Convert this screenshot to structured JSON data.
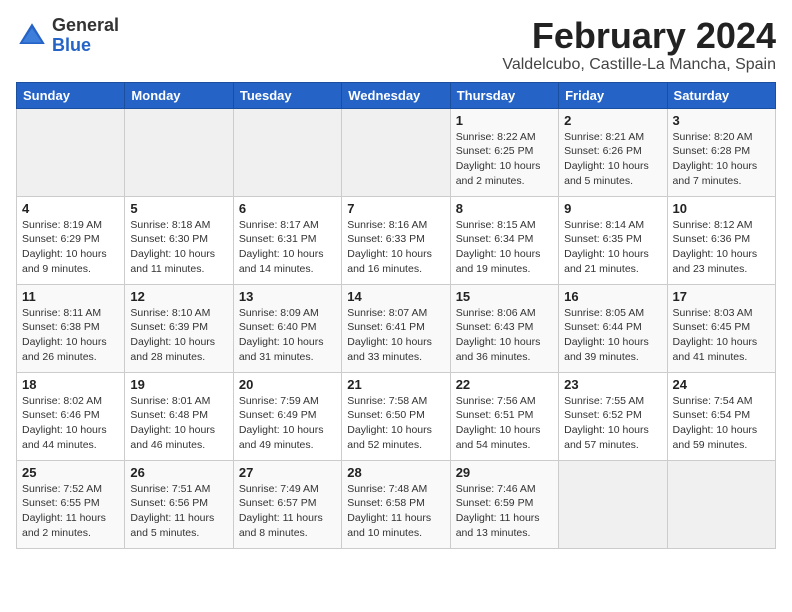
{
  "header": {
    "logo_general": "General",
    "logo_blue": "Blue",
    "month_title": "February 2024",
    "location": "Valdelcubo, Castille-La Mancha, Spain"
  },
  "weekdays": [
    "Sunday",
    "Monday",
    "Tuesday",
    "Wednesday",
    "Thursday",
    "Friday",
    "Saturday"
  ],
  "weeks": [
    [
      {
        "day": "",
        "info": ""
      },
      {
        "day": "",
        "info": ""
      },
      {
        "day": "",
        "info": ""
      },
      {
        "day": "",
        "info": ""
      },
      {
        "day": "1",
        "info": "Sunrise: 8:22 AM\nSunset: 6:25 PM\nDaylight: 10 hours\nand 2 minutes."
      },
      {
        "day": "2",
        "info": "Sunrise: 8:21 AM\nSunset: 6:26 PM\nDaylight: 10 hours\nand 5 minutes."
      },
      {
        "day": "3",
        "info": "Sunrise: 8:20 AM\nSunset: 6:28 PM\nDaylight: 10 hours\nand 7 minutes."
      }
    ],
    [
      {
        "day": "4",
        "info": "Sunrise: 8:19 AM\nSunset: 6:29 PM\nDaylight: 10 hours\nand 9 minutes."
      },
      {
        "day": "5",
        "info": "Sunrise: 8:18 AM\nSunset: 6:30 PM\nDaylight: 10 hours\nand 11 minutes."
      },
      {
        "day": "6",
        "info": "Sunrise: 8:17 AM\nSunset: 6:31 PM\nDaylight: 10 hours\nand 14 minutes."
      },
      {
        "day": "7",
        "info": "Sunrise: 8:16 AM\nSunset: 6:33 PM\nDaylight: 10 hours\nand 16 minutes."
      },
      {
        "day": "8",
        "info": "Sunrise: 8:15 AM\nSunset: 6:34 PM\nDaylight: 10 hours\nand 19 minutes."
      },
      {
        "day": "9",
        "info": "Sunrise: 8:14 AM\nSunset: 6:35 PM\nDaylight: 10 hours\nand 21 minutes."
      },
      {
        "day": "10",
        "info": "Sunrise: 8:12 AM\nSunset: 6:36 PM\nDaylight: 10 hours\nand 23 minutes."
      }
    ],
    [
      {
        "day": "11",
        "info": "Sunrise: 8:11 AM\nSunset: 6:38 PM\nDaylight: 10 hours\nand 26 minutes."
      },
      {
        "day": "12",
        "info": "Sunrise: 8:10 AM\nSunset: 6:39 PM\nDaylight: 10 hours\nand 28 minutes."
      },
      {
        "day": "13",
        "info": "Sunrise: 8:09 AM\nSunset: 6:40 PM\nDaylight: 10 hours\nand 31 minutes."
      },
      {
        "day": "14",
        "info": "Sunrise: 8:07 AM\nSunset: 6:41 PM\nDaylight: 10 hours\nand 33 minutes."
      },
      {
        "day": "15",
        "info": "Sunrise: 8:06 AM\nSunset: 6:43 PM\nDaylight: 10 hours\nand 36 minutes."
      },
      {
        "day": "16",
        "info": "Sunrise: 8:05 AM\nSunset: 6:44 PM\nDaylight: 10 hours\nand 39 minutes."
      },
      {
        "day": "17",
        "info": "Sunrise: 8:03 AM\nSunset: 6:45 PM\nDaylight: 10 hours\nand 41 minutes."
      }
    ],
    [
      {
        "day": "18",
        "info": "Sunrise: 8:02 AM\nSunset: 6:46 PM\nDaylight: 10 hours\nand 44 minutes."
      },
      {
        "day": "19",
        "info": "Sunrise: 8:01 AM\nSunset: 6:48 PM\nDaylight: 10 hours\nand 46 minutes."
      },
      {
        "day": "20",
        "info": "Sunrise: 7:59 AM\nSunset: 6:49 PM\nDaylight: 10 hours\nand 49 minutes."
      },
      {
        "day": "21",
        "info": "Sunrise: 7:58 AM\nSunset: 6:50 PM\nDaylight: 10 hours\nand 52 minutes."
      },
      {
        "day": "22",
        "info": "Sunrise: 7:56 AM\nSunset: 6:51 PM\nDaylight: 10 hours\nand 54 minutes."
      },
      {
        "day": "23",
        "info": "Sunrise: 7:55 AM\nSunset: 6:52 PM\nDaylight: 10 hours\nand 57 minutes."
      },
      {
        "day": "24",
        "info": "Sunrise: 7:54 AM\nSunset: 6:54 PM\nDaylight: 10 hours\nand 59 minutes."
      }
    ],
    [
      {
        "day": "25",
        "info": "Sunrise: 7:52 AM\nSunset: 6:55 PM\nDaylight: 11 hours\nand 2 minutes."
      },
      {
        "day": "26",
        "info": "Sunrise: 7:51 AM\nSunset: 6:56 PM\nDaylight: 11 hours\nand 5 minutes."
      },
      {
        "day": "27",
        "info": "Sunrise: 7:49 AM\nSunset: 6:57 PM\nDaylight: 11 hours\nand 8 minutes."
      },
      {
        "day": "28",
        "info": "Sunrise: 7:48 AM\nSunset: 6:58 PM\nDaylight: 11 hours\nand 10 minutes."
      },
      {
        "day": "29",
        "info": "Sunrise: 7:46 AM\nSunset: 6:59 PM\nDaylight: 11 hours\nand 13 minutes."
      },
      {
        "day": "",
        "info": ""
      },
      {
        "day": "",
        "info": ""
      }
    ]
  ]
}
